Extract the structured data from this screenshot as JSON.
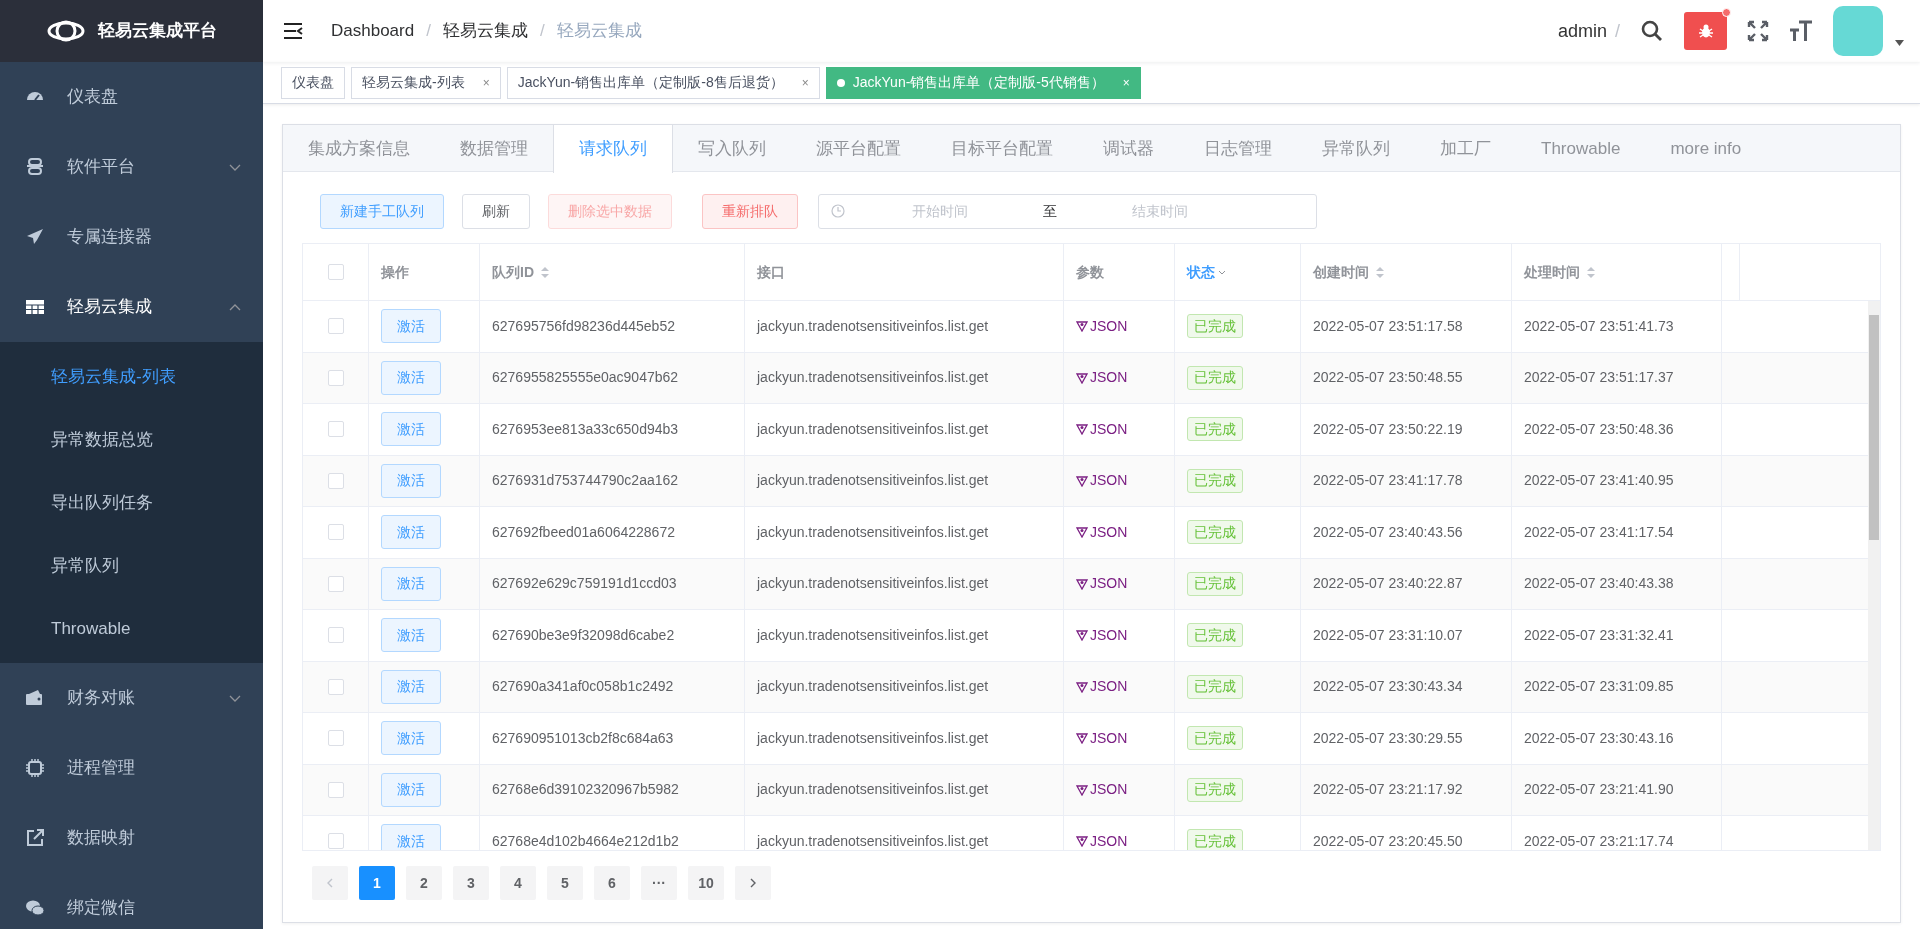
{
  "brand": {
    "title": "轻易云集成平台"
  },
  "breadcrumb": [
    "Dashboard",
    "轻易云集成",
    "轻易云集成"
  ],
  "breadcrumb_separators": [
    "/",
    "/"
  ],
  "navbar": {
    "user": "admin",
    "separator": "/",
    "bug_notification": true
  },
  "sidebar": {
    "items": [
      {
        "label": "仪表盘",
        "kind": "item"
      },
      {
        "label": "软件平台",
        "kind": "group",
        "expanded": false
      },
      {
        "label": "专属连接器",
        "kind": "item"
      },
      {
        "label": "轻易云集成",
        "kind": "group",
        "expanded": true,
        "children": [
          {
            "label": "轻易云集成-列表",
            "selected": true
          },
          {
            "label": "异常数据总览",
            "selected": false
          },
          {
            "label": "导出队列任务",
            "selected": false
          },
          {
            "label": "异常队列",
            "selected": false
          },
          {
            "label": "Throwable",
            "selected": false
          }
        ]
      },
      {
        "label": "财务对账",
        "kind": "group",
        "expanded": false
      },
      {
        "label": "进程管理",
        "kind": "item"
      },
      {
        "label": "数据映射",
        "kind": "item"
      },
      {
        "label": "绑定微信",
        "kind": "item"
      }
    ]
  },
  "tags": [
    {
      "label": "仪表盘",
      "closable": false,
      "selected": false
    },
    {
      "label": "轻易云集成-列表",
      "closable": true,
      "selected": false
    },
    {
      "label": "JackYun-销售出库单（定制版-8售后退货）",
      "closable": true,
      "selected": false
    },
    {
      "label": "JackYun-销售出库单（定制版-5代销售）",
      "closable": true,
      "selected": true
    }
  ],
  "tag_close": "×",
  "tabs": [
    {
      "label": "集成方案信息",
      "selected": false
    },
    {
      "label": "数据管理",
      "selected": false
    },
    {
      "label": "请求队列",
      "selected": true
    },
    {
      "label": "写入队列",
      "selected": false
    },
    {
      "label": "源平台配置",
      "selected": false
    },
    {
      "label": "目标平台配置",
      "selected": false
    },
    {
      "label": "调试器",
      "selected": false
    },
    {
      "label": "日志管理",
      "selected": false
    },
    {
      "label": "异常队列",
      "selected": false
    },
    {
      "label": "加工厂",
      "selected": false
    },
    {
      "label": "Throwable",
      "selected": false
    },
    {
      "label": "more info",
      "selected": false
    }
  ],
  "toolbar": {
    "buttons": [
      {
        "label": "新建手工队列",
        "kind": "primary",
        "disabled": false
      },
      {
        "label": "刷新",
        "kind": "default",
        "disabled": false
      },
      {
        "label": "删除选中数据",
        "kind": "danger",
        "disabled": true
      },
      {
        "label": "重新排队",
        "kind": "danger",
        "disabled": false
      }
    ],
    "date_range": {
      "start_placeholder": "开始时间",
      "separator": "至",
      "end_placeholder": "结束时间"
    }
  },
  "table": {
    "columns": [
      {
        "kind": "checkbox",
        "checked": false
      },
      {
        "label": "操作",
        "sortable": false,
        "filter": false
      },
      {
        "label": "队列ID",
        "sortable": true,
        "filter": false
      },
      {
        "label": "接口",
        "sortable": false,
        "filter": false
      },
      {
        "label": "参数",
        "sortable": false,
        "filter": false
      },
      {
        "label": "状态",
        "sortable": false,
        "filter": true
      },
      {
        "label": "创建时间",
        "sortable": true,
        "filter": false
      },
      {
        "label": "处理时间",
        "sortable": true,
        "filter": false
      }
    ],
    "rows": [
      {
        "checked": false,
        "action": "激活",
        "id": "627695756fd98236d445eb52",
        "api": "jackyun.tradenotsensitiveinfos.list.get",
        "params": "JSON",
        "status": "已完成",
        "created": "2022-05-07 23:51:17.58",
        "processed": "2022-05-07 23:51:41.73"
      },
      {
        "checked": false,
        "action": "激活",
        "id": "6276955825555e0ac9047b62",
        "api": "jackyun.tradenotsensitiveinfos.list.get",
        "params": "JSON",
        "status": "已完成",
        "created": "2022-05-07 23:50:48.55",
        "processed": "2022-05-07 23:51:17.37"
      },
      {
        "checked": false,
        "action": "激活",
        "id": "6276953ee813a33c650d94b3",
        "api": "jackyun.tradenotsensitiveinfos.list.get",
        "params": "JSON",
        "status": "已完成",
        "created": "2022-05-07 23:50:22.19",
        "processed": "2022-05-07 23:50:48.36"
      },
      {
        "checked": false,
        "action": "激活",
        "id": "6276931d753744790c2aa162",
        "api": "jackyun.tradenotsensitiveinfos.list.get",
        "params": "JSON",
        "status": "已完成",
        "created": "2022-05-07 23:41:17.78",
        "processed": "2022-05-07 23:41:40.95"
      },
      {
        "checked": false,
        "action": "激活",
        "id": "627692fbeed01a6064228672",
        "api": "jackyun.tradenotsensitiveinfos.list.get",
        "params": "JSON",
        "status": "已完成",
        "created": "2022-05-07 23:40:43.56",
        "processed": "2022-05-07 23:41:17.54"
      },
      {
        "checked": false,
        "action": "激活",
        "id": "627692e629c759191d1ccd03",
        "api": "jackyun.tradenotsensitiveinfos.list.get",
        "params": "JSON",
        "status": "已完成",
        "created": "2022-05-07 23:40:22.87",
        "processed": "2022-05-07 23:40:43.38"
      },
      {
        "checked": false,
        "action": "激活",
        "id": "627690be3e9f32098d6cabe2",
        "api": "jackyun.tradenotsensitiveinfos.list.get",
        "params": "JSON",
        "status": "已完成",
        "created": "2022-05-07 23:31:10.07",
        "processed": "2022-05-07 23:31:32.41"
      },
      {
        "checked": false,
        "action": "激活",
        "id": "627690a341af0c058b1c2492",
        "api": "jackyun.tradenotsensitiveinfos.list.get",
        "params": "JSON",
        "status": "已完成",
        "created": "2022-05-07 23:30:43.34",
        "processed": "2022-05-07 23:31:09.85"
      },
      {
        "checked": false,
        "action": "激活",
        "id": "627690951013cb2f8c684a63",
        "api": "jackyun.tradenotsensitiveinfos.list.get",
        "params": "JSON",
        "status": "已完成",
        "created": "2022-05-07 23:30:29.55",
        "processed": "2022-05-07 23:30:43.16"
      },
      {
        "checked": false,
        "action": "激活",
        "id": "62768e6d39102320967b5982",
        "api": "jackyun.tradenotsensitiveinfos.list.get",
        "params": "JSON",
        "status": "已完成",
        "created": "2022-05-07 23:21:17.92",
        "processed": "2022-05-07 23:21:41.90"
      },
      {
        "checked": false,
        "action": "激活",
        "id": "62768e4d102b4664e212d1b2",
        "api": "jackyun.tradenotsensitiveinfos.list.get",
        "params": "JSON",
        "status": "已完成",
        "created": "2022-05-07 23:20:45.50",
        "processed": "2022-05-07 23:21:17.74"
      }
    ]
  },
  "pagination": {
    "prev_disabled": true,
    "pages": [
      {
        "label": "1",
        "selected": true
      },
      {
        "label": "2",
        "selected": false
      },
      {
        "label": "3",
        "selected": false
      },
      {
        "label": "4",
        "selected": false
      },
      {
        "label": "5",
        "selected": false
      },
      {
        "label": "6",
        "selected": false
      },
      {
        "label": "···",
        "selected": false
      },
      {
        "label": "10",
        "selected": false
      }
    ]
  }
}
